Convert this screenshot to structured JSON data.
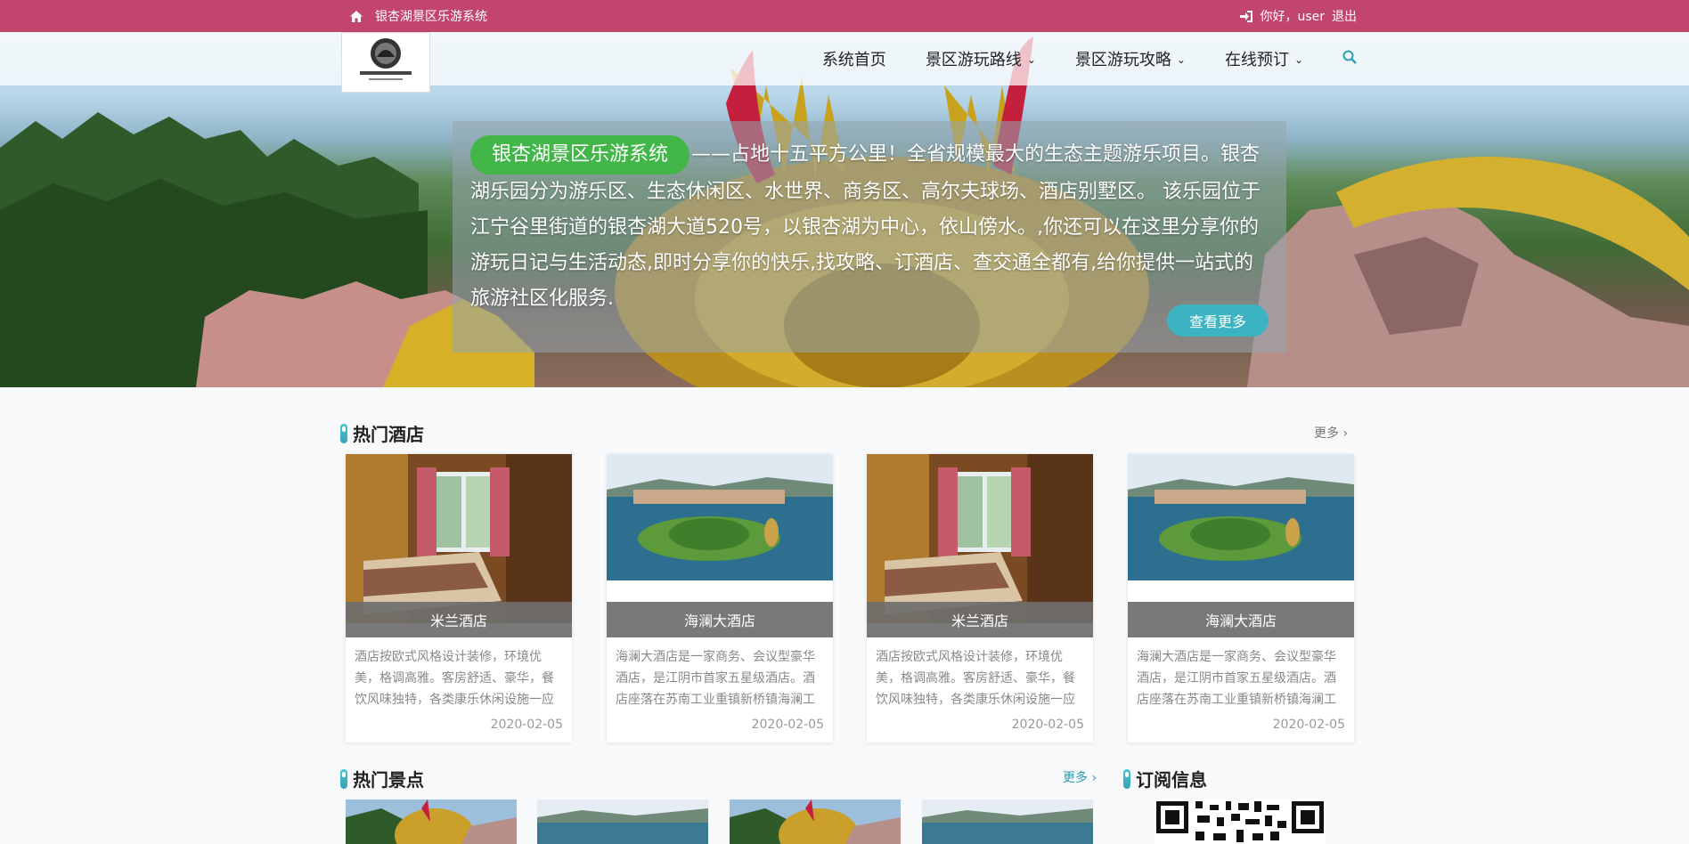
{
  "topbar": {
    "home_icon": "home-icon",
    "site_name": "银杏湖景区乐游系统",
    "login_icon": "sign-in-icon",
    "greeting": "你好，user",
    "logout": "退出"
  },
  "header": {
    "logo_alt": "银杏湖风景区",
    "nav": [
      {
        "label": "系统首页",
        "has_dropdown": false
      },
      {
        "label": "景区游玩路线",
        "has_dropdown": true
      },
      {
        "label": "景区游玩攻略",
        "has_dropdown": true
      },
      {
        "label": "在线预订",
        "has_dropdown": true
      }
    ],
    "search_icon": "search-icon"
  },
  "hero": {
    "brand": "银杏湖景区乐游系统",
    "text": "——占地十五平方公里！全省规模最大的生态主题游乐项目。银杏湖乐园分为游乐区、生态休闲区、水世界、商务区、高尔夫球场、酒店别墅区。 该乐园位于江宁谷里街道的银杏湖大道520号，以银杏湖为中心，依山傍水。,你还可以在这里分享你的游玩日记与生活动态,即时分享你的快乐,找攻略、订酒店、查交通全都有,给你提供一站式的旅游社区化服务.",
    "button": "查看更多"
  },
  "hotels": {
    "title": "热门酒店",
    "more": "更多",
    "items": [
      {
        "name": "米兰酒店",
        "desc": "酒店按欧式风格设计装修，环境优美，格调高雅。客房舒适、豪华，餐饮风味独特，各类康乐休闲设施一应",
        "date": "2020-02-05",
        "image": "hotel-room"
      },
      {
        "name": "海澜大酒店",
        "desc": "海澜大酒店是一家商务、会议型豪华酒店，是江阴市首家五星级酒店。酒店座落在苏南工业重镇新桥镇海澜工",
        "date": "2020-02-05",
        "image": "lake-island"
      },
      {
        "name": "米兰酒店",
        "desc": "酒店按欧式风格设计装修，环境优美，格调高雅。客房舒适、豪华，餐饮风味独特，各类康乐休闲设施一应",
        "date": "2020-02-05",
        "image": "hotel-room"
      },
      {
        "name": "海澜大酒店",
        "desc": "海澜大酒店是一家商务、会议型豪华酒店，是江阴市首家五星级酒店。酒店座落在苏南工业重镇新桥镇海澜工",
        "date": "2020-02-05",
        "image": "lake-island"
      }
    ]
  },
  "attractions": {
    "title": "热门景点",
    "more": "更多"
  },
  "subscribe": {
    "title": "订阅信息"
  },
  "colors": {
    "topbar": "#c2456d",
    "brand_green": "#42b649",
    "accent_teal": "#3bb3c1"
  }
}
